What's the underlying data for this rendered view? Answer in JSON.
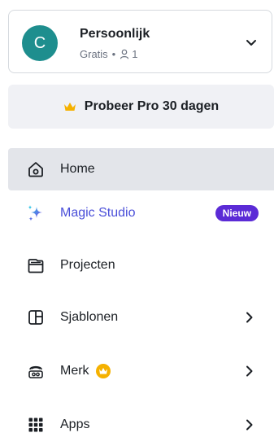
{
  "account": {
    "avatar_letter": "C",
    "name": "Persoonlijk",
    "plan": "Gratis",
    "separator": "•",
    "member_count": "1"
  },
  "promo": {
    "label": "Probeer Pro 30 dagen",
    "icon": "crown-icon"
  },
  "nav": {
    "items": [
      {
        "label": "Home",
        "icon": "home-icon",
        "active": true
      },
      {
        "label": "Magic Studio",
        "icon": "sparkle-icon",
        "badge": "Nieuw"
      },
      {
        "label": "Projecten",
        "icon": "folder-icon"
      },
      {
        "label": "Sjablonen",
        "icon": "template-icon",
        "has_submenu": true
      },
      {
        "label": "Merk",
        "icon": "brand-icon",
        "has_crown": true,
        "has_submenu": true
      },
      {
        "label": "Apps",
        "icon": "apps-grid-icon",
        "has_submenu": true
      }
    ]
  },
  "colors": {
    "avatar_bg": "#1e8e8e",
    "magic_text": "#4a4fd9",
    "badge_bg": "#5b2bd6",
    "crown": "#f5b100",
    "active_bg": "#e3e5ea"
  }
}
